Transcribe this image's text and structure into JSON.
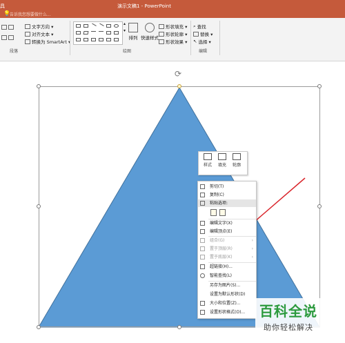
{
  "window": {
    "title": "演示文稿1 - PowerPoint",
    "left_label": "具"
  },
  "tellme": {
    "placeholder": "告诉我您想要做什么..."
  },
  "ribbon": {
    "paragraph": {
      "text_direction": "文字方向 ▾",
      "align_text": "对齐文本 ▾",
      "convert_smartart": "转换为 SmartArt ▾",
      "group_label": "段落"
    },
    "drawing": {
      "arrange": "排列",
      "quick_styles": "快速样式",
      "shape_fill": "形状填充 ▾",
      "shape_outline": "形状轮廓 ▾",
      "shape_effects": "形状效果 ▾",
      "group_label": "绘图"
    },
    "editing": {
      "find": "查找",
      "replace": "替换 ▾",
      "select": "选择 ▾",
      "group_label": "编辑"
    }
  },
  "mini_toolbar": {
    "style": "样式",
    "fill": "填充",
    "outline": "轮廓"
  },
  "context_menu": {
    "cut": "剪切(T)",
    "copy": "复制(C)",
    "paste_options": "粘贴选项:",
    "edit_text": "编辑文字(X)",
    "edit_points": "编辑顶点(E)",
    "group": "组合(G)",
    "bring_to_front": "置于顶层(R)",
    "send_to_back": "置于底层(K)",
    "hyperlink": "超链接(H)...",
    "smart_lookup": "智能查找(L)",
    "save_as_picture": "另存为图片(S)...",
    "set_default_shape": "设置为默认形状(D)",
    "size_position": "大小和位置(Z)...",
    "format_shape": "设置形状格式(O)..."
  },
  "watermark": {
    "title": "百科全说",
    "subtitle": "助你轻松解决"
  },
  "colors": {
    "titlebar": "#c55a3b",
    "shape_fill": "#5b9bd5",
    "shape_stroke": "#41719c",
    "arrow": "#d9242a",
    "watermark_green": "#2c9a3e"
  }
}
